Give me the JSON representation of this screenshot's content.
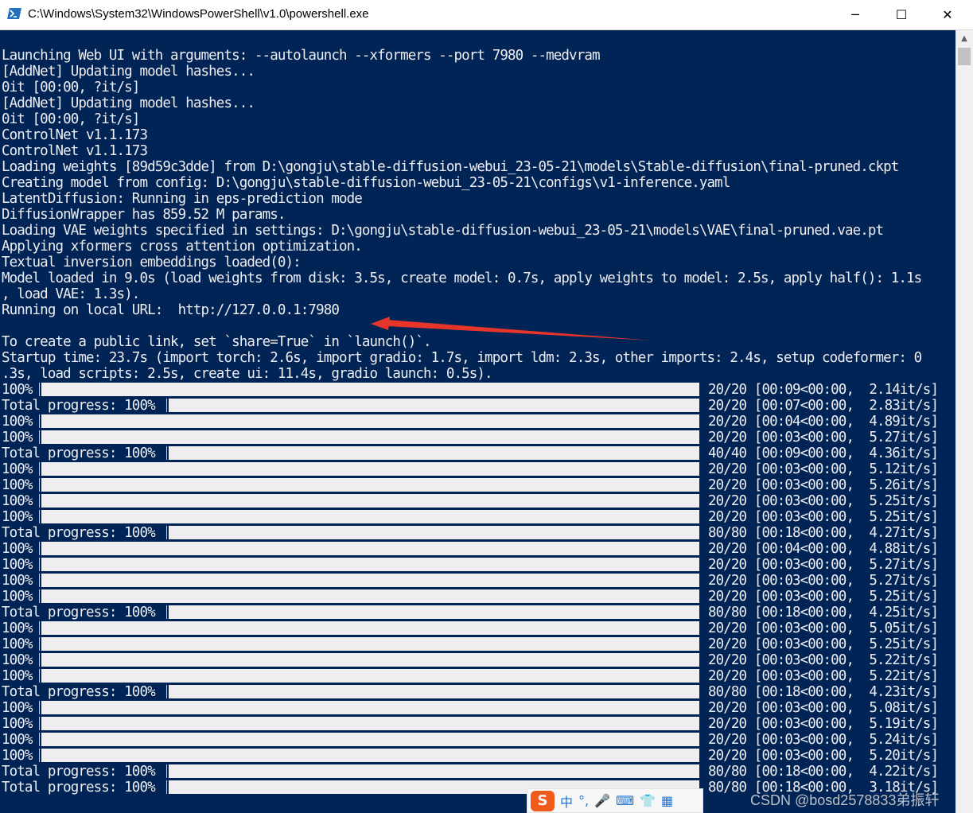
{
  "window": {
    "title": "C:\\Windows\\System32\\WindowsPowerShell\\v1.0\\powershell.exe",
    "icon": "powershell-icon",
    "controls": {
      "minimize": "─",
      "maximize": "☐",
      "close": "✕"
    }
  },
  "colors": {
    "console_bg": "#012456",
    "console_fg": "#eeedf0",
    "arrow": "#e8352a"
  },
  "console": {
    "lines": [
      "",
      "Launching Web UI with arguments: --autolaunch --xformers --port 7980 --medvram",
      "[AddNet] Updating model hashes...",
      "0it [00:00, ?it/s]",
      "[AddNet] Updating model hashes...",
      "0it [00:00, ?it/s]",
      "ControlNet v1.1.173",
      "ControlNet v1.1.173",
      "Loading weights [89d59c3dde] from D:\\gongju\\stable-diffusion-webui_23-05-21\\models\\Stable-diffusion\\final-pruned.ckpt",
      "Creating model from config: D:\\gongju\\stable-diffusion-webui_23-05-21\\configs\\v1-inference.yaml",
      "LatentDiffusion: Running in eps-prediction mode",
      "DiffusionWrapper has 859.52 M params.",
      "Loading VAE weights specified in settings: D:\\gongju\\stable-diffusion-webui_23-05-21\\models\\VAE\\final-pruned.vae.pt",
      "Applying xformers cross attention optimization.",
      "Textual inversion embeddings loaded(0):",
      "Model loaded in 9.0s (load weights from disk: 3.5s, create model: 0.7s, apply weights to model: 2.5s, apply half(): 1.1s",
      ", load VAE: 1.3s).",
      "Running on local URL:  http://127.0.0.1:7980",
      "",
      "To create a public link, set `share=True` in `launch()`.",
      "Startup time: 23.7s (import torch: 2.6s, import gradio: 1.7s, import ldm: 2.3s, other imports: 2.4s, setup codeformer: 0",
      ".3s, load scripts: 2.5s, create ui: 11.4s, gradio launch: 0.5s)."
    ],
    "progress": [
      {
        "label": "100%",
        "stats": "20/20 [00:09<00:00,  2.14it/s]"
      },
      {
        "label": "Total progress: 100%",
        "stats": "20/20 [00:07<00:00,  2.83it/s]"
      },
      {
        "label": "100%",
        "stats": "20/20 [00:04<00:00,  4.89it/s]"
      },
      {
        "label": "100%",
        "stats": "20/20 [00:03<00:00,  5.27it/s]"
      },
      {
        "label": "Total progress: 100%",
        "stats": "40/40 [00:09<00:00,  4.36it/s]"
      },
      {
        "label": "100%",
        "stats": "20/20 [00:03<00:00,  5.12it/s]"
      },
      {
        "label": "100%",
        "stats": "20/20 [00:03<00:00,  5.26it/s]"
      },
      {
        "label": "100%",
        "stats": "20/20 [00:03<00:00,  5.25it/s]"
      },
      {
        "label": "100%",
        "stats": "20/20 [00:03<00:00,  5.25it/s]"
      },
      {
        "label": "Total progress: 100%",
        "stats": "80/80 [00:18<00:00,  4.27it/s]"
      },
      {
        "label": "100%",
        "stats": "20/20 [00:04<00:00,  4.88it/s]"
      },
      {
        "label": "100%",
        "stats": "20/20 [00:03<00:00,  5.27it/s]"
      },
      {
        "label": "100%",
        "stats": "20/20 [00:03<00:00,  5.27it/s]"
      },
      {
        "label": "100%",
        "stats": "20/20 [00:03<00:00,  5.25it/s]"
      },
      {
        "label": "Total progress: 100%",
        "stats": "80/80 [00:18<00:00,  4.25it/s]"
      },
      {
        "label": "100%",
        "stats": "20/20 [00:03<00:00,  5.05it/s]"
      },
      {
        "label": "100%",
        "stats": "20/20 [00:03<00:00,  5.25it/s]"
      },
      {
        "label": "100%",
        "stats": "20/20 [00:03<00:00,  5.22it/s]"
      },
      {
        "label": "100%",
        "stats": "20/20 [00:03<00:00,  5.22it/s]"
      },
      {
        "label": "Total progress: 100%",
        "stats": "80/80 [00:18<00:00,  4.23it/s]"
      },
      {
        "label": "100%",
        "stats": "20/20 [00:03<00:00,  5.08it/s]"
      },
      {
        "label": "100%",
        "stats": "20/20 [00:03<00:00,  5.19it/s]"
      },
      {
        "label": "100%",
        "stats": "20/20 [00:03<00:00,  5.24it/s]"
      },
      {
        "label": "100%",
        "stats": "20/20 [00:03<00:00,  5.20it/s]"
      },
      {
        "label": "Total progress: 100%",
        "stats": "80/80 [00:18<00:00,  4.22it/s]"
      },
      {
        "label": "Total progress: 100%",
        "stats": "80/80 [00:18<00:00,  3.18it/s]"
      }
    ]
  },
  "ime_toolbar": {
    "logo": "S",
    "items": [
      {
        "icon": "chinese-mode-icon",
        "text": "中"
      },
      {
        "icon": "punctuation-icon",
        "text": "°,"
      },
      {
        "icon": "microphone-icon",
        "text": "🎤"
      },
      {
        "icon": "keyboard-icon",
        "text": "⌨"
      },
      {
        "icon": "skin-icon",
        "text": "👕"
      },
      {
        "icon": "toolbox-icon",
        "text": "▦"
      }
    ]
  },
  "watermark": "CSDN @bosd2578833弟振轩"
}
